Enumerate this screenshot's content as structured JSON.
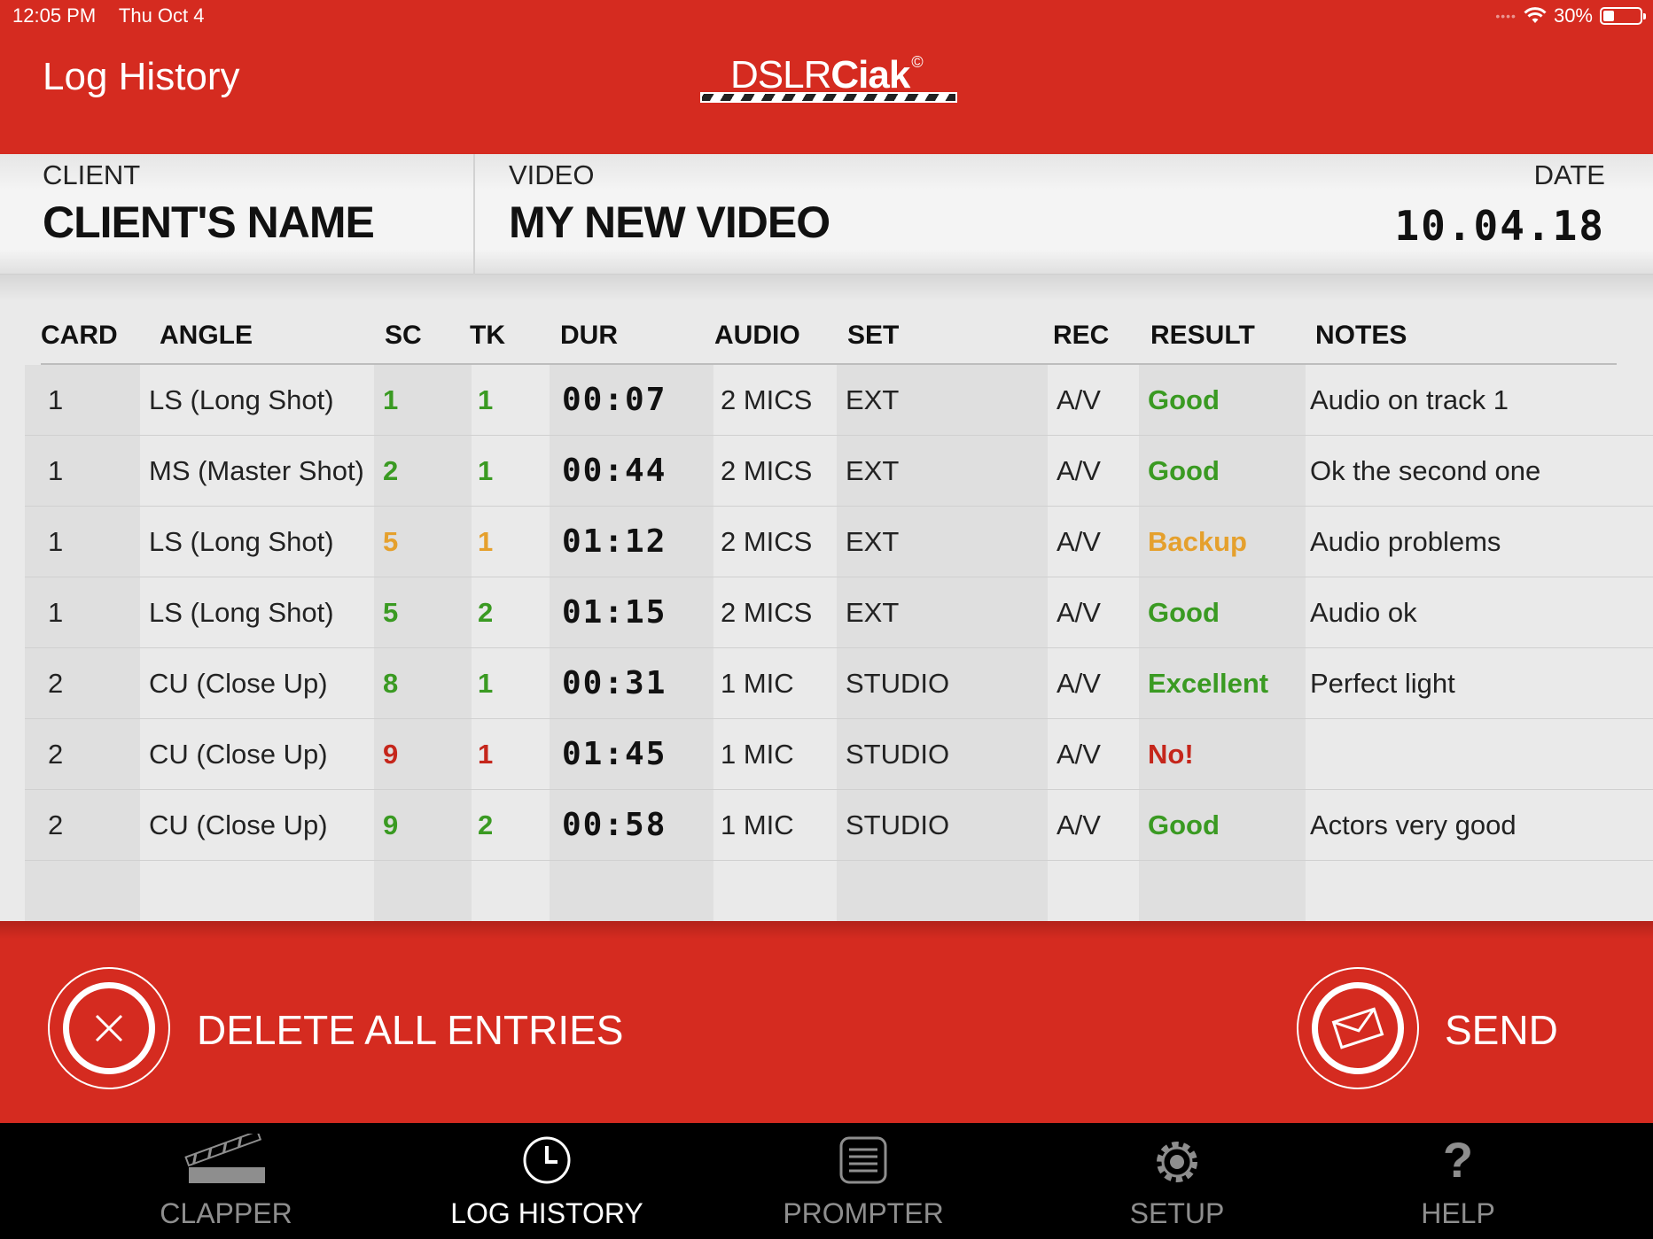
{
  "status_bar": {
    "time": "12:05 PM",
    "date": "Thu Oct 4",
    "battery": "30%",
    "battery_level": 0.3
  },
  "header": {
    "title": "Log History",
    "logo_light": "DSLR",
    "logo_bold": "Ciak",
    "logo_mark": "©"
  },
  "info": {
    "client_label": "CLIENT",
    "client_name": "CLIENT'S NAME",
    "video_label": "VIDEO",
    "video_name": "MY NEW VIDEO",
    "date_label": "DATE",
    "date_value": "10.04.18"
  },
  "table": {
    "headers": {
      "card": "CARD",
      "angle": "ANGLE",
      "sc": "SC",
      "tk": "TK",
      "dur": "DUR",
      "audio": "AUDIO",
      "set": "SET",
      "rec": "REC",
      "result": "RESULT",
      "notes": "NOTES"
    },
    "rows": [
      {
        "card": "1",
        "angle": "LS (Long Shot)",
        "sc": "1",
        "tk": "1",
        "dur": "00:07",
        "audio": "2 MICS",
        "set": "EXT",
        "rec": "A/V",
        "result": "Good",
        "notes": "Audio on track 1",
        "color": "#3a9a22"
      },
      {
        "card": "1",
        "angle": "MS (Master Shot)",
        "sc": "2",
        "tk": "1",
        "dur": "00:44",
        "audio": "2 MICS",
        "set": "EXT",
        "rec": "A/V",
        "result": "Good",
        "notes": "Ok the second one",
        "color": "#3a9a22"
      },
      {
        "card": "1",
        "angle": "LS (Long Shot)",
        "sc": "5",
        "tk": "1",
        "dur": "01:12",
        "audio": "2 MICS",
        "set": "EXT",
        "rec": "A/V",
        "result": "Backup",
        "notes": "Audio problems",
        "color": "#e5a02d"
      },
      {
        "card": "1",
        "angle": "LS (Long Shot)",
        "sc": "5",
        "tk": "2",
        "dur": "01:15",
        "audio": "2 MICS",
        "set": "EXT",
        "rec": "A/V",
        "result": "Good",
        "notes": "Audio ok",
        "color": "#3a9a22"
      },
      {
        "card": "2",
        "angle": "CU (Close Up)",
        "sc": "8",
        "tk": "1",
        "dur": "00:31",
        "audio": "1 MIC",
        "set": "STUDIO",
        "rec": "A/V",
        "result": "Excellent",
        "notes": "Perfect light",
        "color": "#3a9a22"
      },
      {
        "card": "2",
        "angle": "CU (Close Up)",
        "sc": "9",
        "tk": "1",
        "dur": "01:45",
        "audio": "1 MIC",
        "set": "STUDIO",
        "rec": "A/V",
        "result": "No!",
        "notes": "",
        "color": "#c5261b"
      },
      {
        "card": "2",
        "angle": "CU (Close Up)",
        "sc": "9",
        "tk": "2",
        "dur": "00:58",
        "audio": "1 MIC",
        "set": "STUDIO",
        "rec": "A/V",
        "result": "Good",
        "notes": "Actors very good",
        "color": "#3a9a22"
      }
    ]
  },
  "actions": {
    "delete_label": "DELETE ALL ENTRIES",
    "send_label": "SEND"
  },
  "tabs": [
    {
      "label": "CLAPPER",
      "icon": "clapper-icon"
    },
    {
      "label": "LOG HISTORY",
      "icon": "clock-icon",
      "active": true
    },
    {
      "label": "PROMPTER",
      "icon": "prompter-icon"
    },
    {
      "label": "SETUP",
      "icon": "gear-icon"
    },
    {
      "label": "HELP",
      "icon": "question-icon"
    }
  ],
  "colors": {
    "brand_red": "#d52b20",
    "good": "#3a9a22",
    "backup": "#e5a02d",
    "bad": "#c5261b"
  }
}
